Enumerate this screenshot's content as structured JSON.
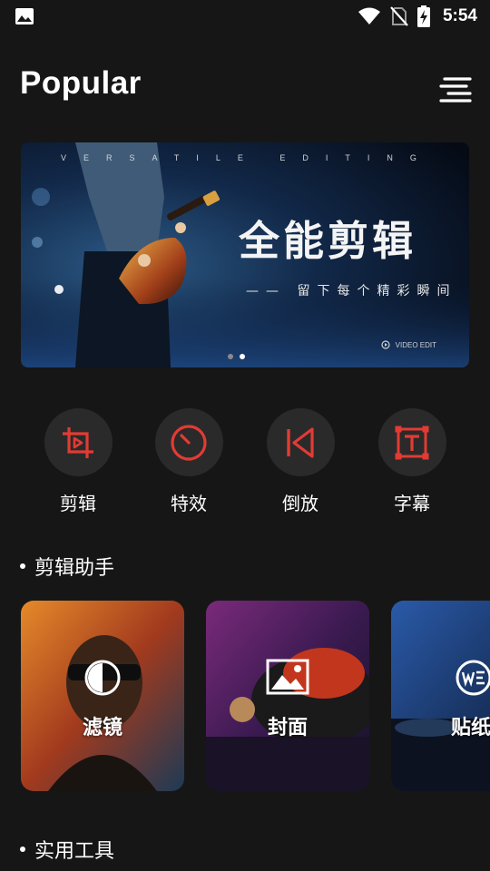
{
  "status_bar": {
    "time": "5:54",
    "icons": [
      "gallery-icon",
      "wifi-icon",
      "no-sim-icon",
      "battery-charging-icon"
    ]
  },
  "header": {
    "title": "Popular",
    "menu_icon": "menu-icon"
  },
  "banner": {
    "tagline": "VERSATILE EDITING",
    "title": "全能剪辑",
    "subtitle": "—— 留下每个精彩瞬间",
    "brand": "VIDEO EDIT",
    "dots": 2,
    "active_dot": 1
  },
  "tools": [
    {
      "label": "剪辑",
      "icon": "crop-play-icon"
    },
    {
      "label": "特效",
      "icon": "timer-icon"
    },
    {
      "label": "倒放",
      "icon": "rewind-icon"
    },
    {
      "label": "字幕",
      "icon": "text-box-icon"
    }
  ],
  "sections": {
    "assistant": "剪辑助手",
    "utilities": "实用工具"
  },
  "cards": [
    {
      "label": "滤镜",
      "icon": "filter-icon"
    },
    {
      "label": "封面",
      "icon": "image-icon"
    },
    {
      "label": "贴纸",
      "icon": "we-badge-icon"
    }
  ],
  "colors": {
    "background": "#161616",
    "accent": "#e23b33",
    "tool_circle": "#2a2a2a"
  }
}
